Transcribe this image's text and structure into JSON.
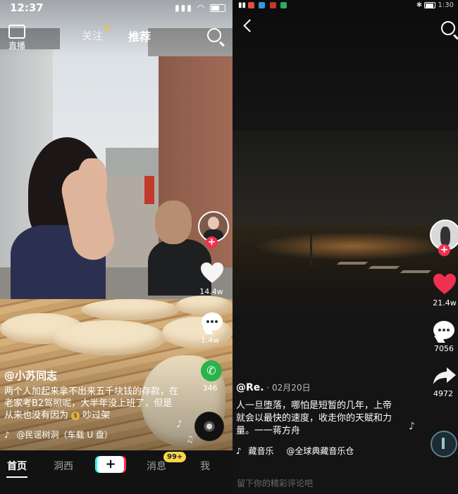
{
  "left": {
    "status": {
      "time": "12:37"
    },
    "top_nav": {
      "live_label": "直播",
      "follow_tab": "关注",
      "recommend_tab": "推荐"
    },
    "rail": {
      "like_count": "14.4w",
      "comment_count": "1.4w",
      "share_count": "346"
    },
    "post": {
      "author": "@小苏同志",
      "caption": "两个人加起来拿不出来五千块钱的存款，在老家考B2驾照呢，大半年没上班了，但是从来也没有因为",
      "caption_tail": "吵过架",
      "music": "@民谣树洞（车载 U 盘）"
    },
    "bottom_nav": {
      "home": "首页",
      "second": "洞西",
      "plus": "+",
      "messages": "消息",
      "messages_badge": "99+",
      "me": "我"
    }
  },
  "right": {
    "status": {
      "time": "1:30"
    },
    "rail": {
      "like_count": "21.4w",
      "comment_count": "7056",
      "share_count": "4972"
    },
    "post": {
      "author": "@Re.",
      "date": " · 02月20日",
      "caption": "人一旦堕落，哪怕是短暂的几年，上帝就会以最快的速度，收走你的天赋和力量。一一蒋方舟",
      "music_label": "藏音乐",
      "music": "@全球典藏音乐仓"
    },
    "comment_placeholder": "留下你的精彩评论吧"
  },
  "colors": {
    "like_red": "#f0304f",
    "badge_yellow": "#f7d54b",
    "wechat_green": "#2bb34a"
  }
}
